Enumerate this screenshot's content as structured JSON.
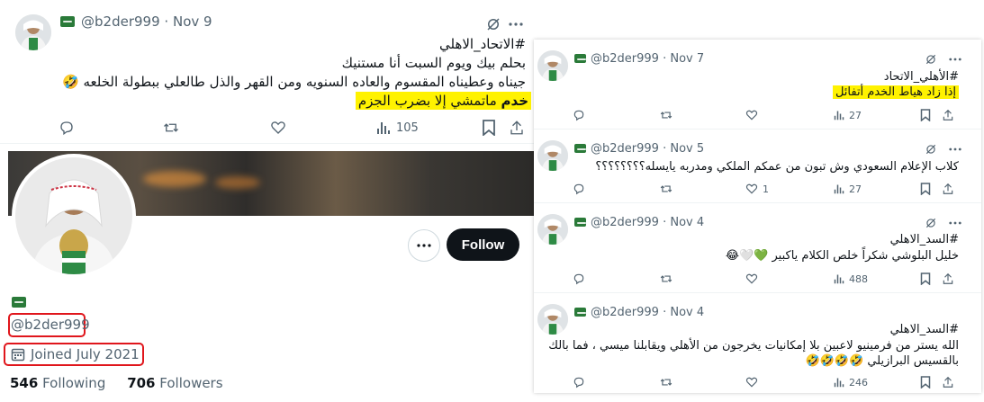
{
  "main_tweet": {
    "handle": "@b2der999",
    "date": "Nov 9",
    "hashtag": "#الاتحاد_الاهلي",
    "line1": "بحلم بيك ويوم السبت أنا مستنيك",
    "line2": "جيناه وعطيناه المقسوم والعاده السنويه ومن القهر والذل طالعلي ببطولة الخلعه 🤣",
    "line3_bold": "خدم",
    "line3_rest": "ماتمشي إلا بضرب الجزم",
    "views": "105"
  },
  "profile": {
    "handle": "@b2der999",
    "joined": "Joined July 2021",
    "following_count": "546",
    "following_label": "Following",
    "followers_count": "706",
    "followers_label": "Followers",
    "follow_button": "Follow"
  },
  "right_tweets": [
    {
      "handle": "@b2der999",
      "date": "Nov 7",
      "hashtag": "#الأهلي_الاتحاد",
      "text": "إذا زاد هياط الخدم أتفائل",
      "replies": "",
      "likes": "",
      "views": "27"
    },
    {
      "handle": "@b2der999",
      "date": "Nov 5",
      "hashtag": "",
      "text": "كلاب الإعلام السعودي وش تبون من عمكم الملكي ومدربه يايسله؟؟؟؟؟؟؟؟",
      "replies": "",
      "likes": "1",
      "views": "27"
    },
    {
      "handle": "@b2der999",
      "date": "Nov 4",
      "hashtag": "#السد_الاهلي",
      "text": "خليل البلوشي شكراً خلص الكلام ياكبير 💚🤍😂",
      "replies": "",
      "likes": "",
      "views": "488"
    },
    {
      "handle": "@b2der999",
      "date": "Nov 4",
      "hashtag": "#السد_الاهلي",
      "text": "الله يستر من فرمينيو لاعبين بلا إمكانيات يخرجون من الأهلي ويقابلنا ميسي ، فما بالك",
      "text2": "بالقسيس البرازيلي 🤣🤣🤣🤣",
      "replies": "",
      "likes": "",
      "views": "246"
    }
  ]
}
